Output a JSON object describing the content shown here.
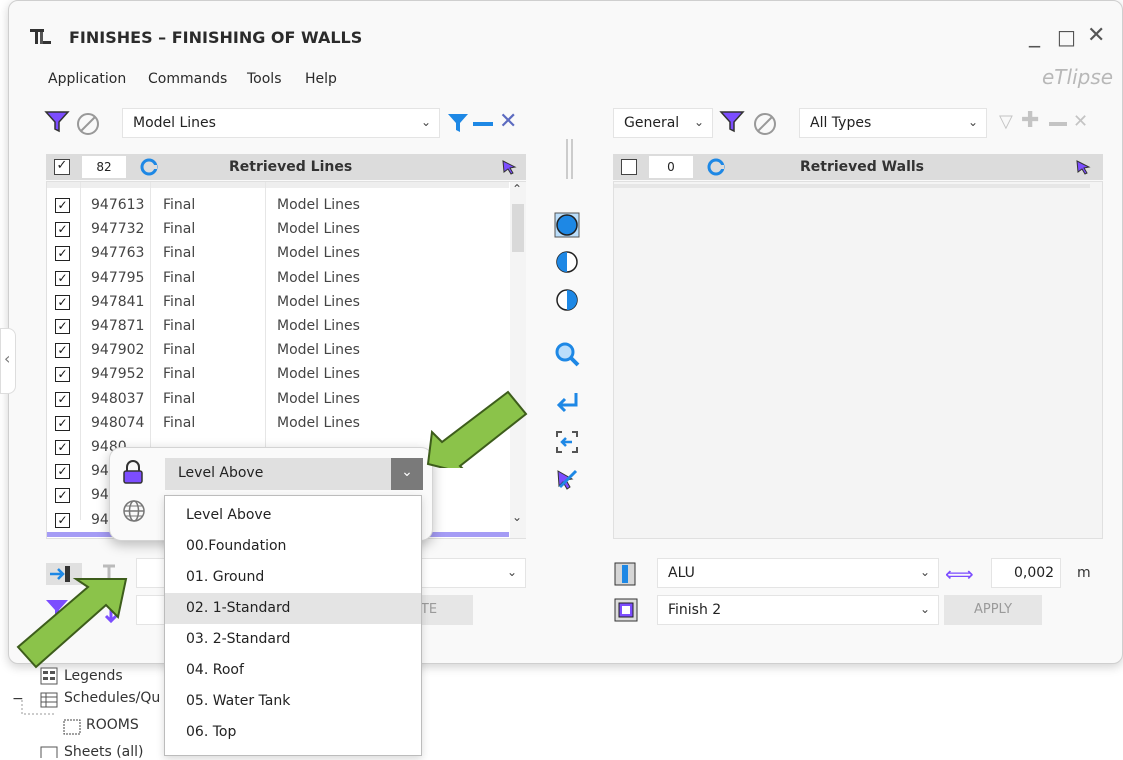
{
  "window": {
    "logo": "TL",
    "title": "FINISHES – FINISHING OF WALLS",
    "brand": "eTlipse",
    "controls": {
      "minimize": "_",
      "maximize": "□",
      "close": "✕"
    }
  },
  "menu": [
    "Application",
    "Commands",
    "Tools",
    "Help"
  ],
  "left_panel": {
    "filter_combo": "Model Lines",
    "header": {
      "count": "82",
      "title": "Retrieved Lines",
      "checked": true
    },
    "rows": [
      {
        "id": "947613",
        "status": "Final",
        "type": "Model Lines"
      },
      {
        "id": "947732",
        "status": "Final",
        "type": "Model Lines"
      },
      {
        "id": "947763",
        "status": "Final",
        "type": "Model Lines"
      },
      {
        "id": "947795",
        "status": "Final",
        "type": "Model Lines"
      },
      {
        "id": "947841",
        "status": "Final",
        "type": "Model Lines"
      },
      {
        "id": "947871",
        "status": "Final",
        "type": "Model Lines"
      },
      {
        "id": "947902",
        "status": "Final",
        "type": "Model Lines"
      },
      {
        "id": "947952",
        "status": "Final",
        "type": "Model Lines"
      },
      {
        "id": "948037",
        "status": "Final",
        "type": "Model Lines"
      },
      {
        "id": "948074",
        "status": "Final",
        "type": "Model Lines"
      },
      {
        "id": "9480",
        "status": "",
        "type": ""
      },
      {
        "id": "948",
        "status": "",
        "type": ""
      },
      {
        "id": "948",
        "status": "",
        "type": ""
      },
      {
        "id": "948",
        "status": "",
        "type": ""
      }
    ],
    "bottom_button": "TE"
  },
  "right_panel": {
    "category_combo": "General",
    "type_combo": "All Types",
    "header": {
      "count": "0",
      "title": "Retrieved Walls",
      "checked": false
    },
    "material_combo": "ALU",
    "offset_value": "0,002",
    "offset_unit": "m",
    "finish_combo": "Finish 2",
    "apply_label": "APPLY"
  },
  "level_popup": {
    "selected": "Level Above",
    "options": [
      "Level Above",
      "00.Foundation",
      "01. Ground",
      "02. 1-Standard",
      "03. 2-Standard",
      "04. Roof",
      "05. Water Tank",
      "06. Top"
    ],
    "highlighted_index": 3
  },
  "project_tree": {
    "items": [
      "Legends",
      "Schedules/Qu",
      "ROOMS",
      "Sheets (all)"
    ]
  },
  "colors": {
    "accent_blue": "#1e88e5",
    "purple": "#7c4dff",
    "arrow_green": "#8bc34a"
  }
}
